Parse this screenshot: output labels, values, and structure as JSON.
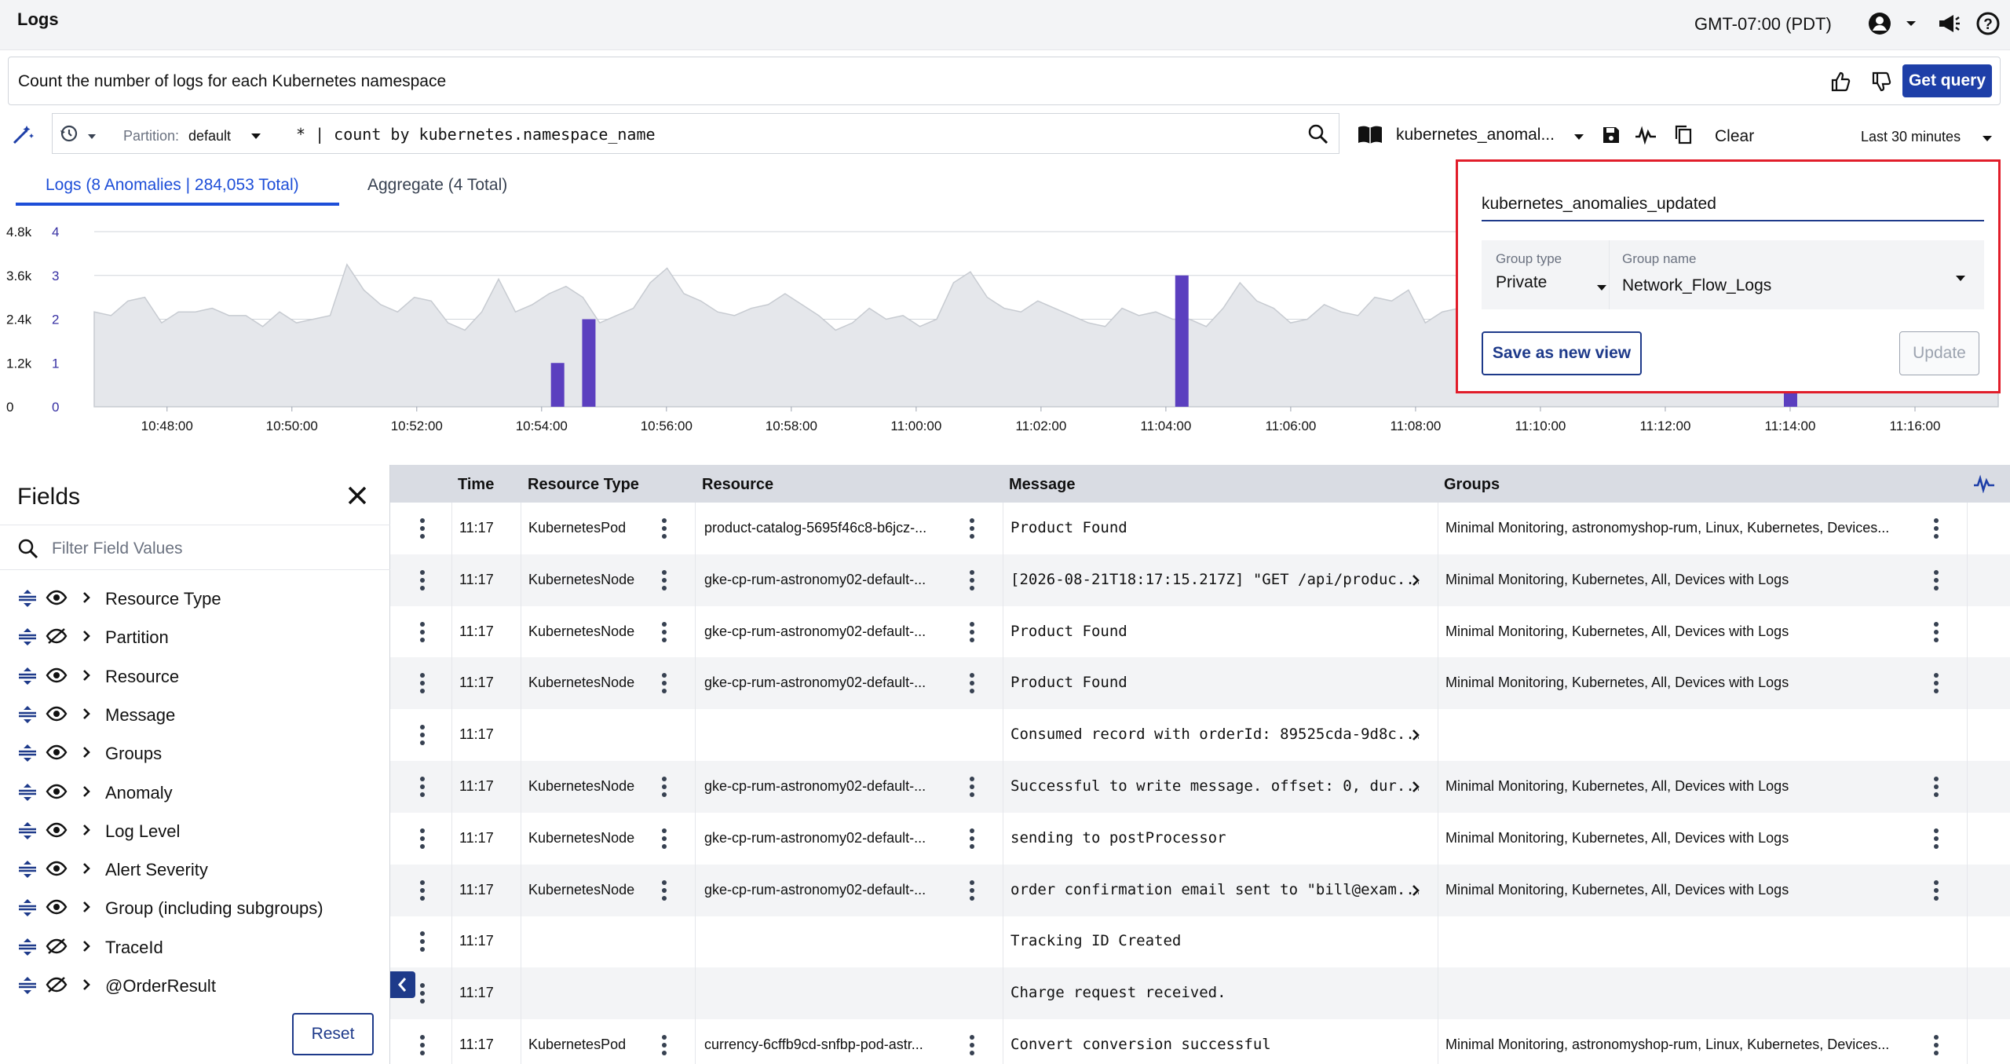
{
  "app": {
    "title": "Logs",
    "timezone": "GMT-07:00 (PDT)"
  },
  "nl_query": {
    "text": "Count the number of logs for each Kubernetes namespace",
    "get_query_label": "Get query"
  },
  "query": {
    "partition_label": "Partition:",
    "partition_value": "default",
    "text": "* | count by kubernetes.namespace_name",
    "view_name": "kubernetes_anomal...",
    "clear_label": "Clear",
    "time_range": "Last 30 minutes"
  },
  "tabs": [
    {
      "label": "Logs (8 Anomalies | 284,053 Total)",
      "active": true
    },
    {
      "label": "Aggregate (4 Total)",
      "active": false
    }
  ],
  "chart_data": {
    "type": "area",
    "y_left_ticks": [
      "4.8k",
      "3.6k",
      "2.4k",
      "1.2k",
      "0"
    ],
    "y_right_ticks": [
      "4",
      "3",
      "2",
      "1",
      "0"
    ],
    "x_ticks": [
      "10:48:00",
      "10:50:00",
      "10:52:00",
      "10:54:00",
      "10:56:00",
      "10:58:00",
      "11:00:00",
      "11:02:00",
      "11:04:00",
      "11:06:00",
      "11:08:00",
      "11:10:00",
      "11:12:00",
      "11:14:00",
      "11:16:00"
    ],
    "ylim_left": [
      0,
      4800
    ],
    "ylim_right": [
      0,
      4
    ],
    "series": [
      {
        "name": "logs",
        "color": "#e5e7eb",
        "values": [
          2600,
          2500,
          2900,
          3000,
          2300,
          2600,
          2600,
          2700,
          2500,
          2500,
          2200,
          2600,
          2300,
          2400,
          2500,
          3900,
          3200,
          2800,
          2600,
          3000,
          2900,
          2300,
          2100,
          2600,
          3500,
          2600,
          2800,
          3100,
          3300,
          3000,
          2300,
          2500,
          2700,
          3400,
          3800,
          3100,
          2900,
          2600,
          2500,
          2700,
          2800,
          3100,
          2800,
          2500,
          2100,
          2300,
          2700,
          2400,
          2500,
          2200,
          2400,
          3400,
          3700,
          3000,
          2700,
          2600,
          2900,
          2700,
          2500,
          2300,
          2200,
          2700,
          2500,
          2600,
          2400,
          2400,
          2200,
          2700,
          3400,
          2900,
          2700,
          2300,
          2400,
          2800,
          2600,
          2500,
          3000,
          2900,
          3200,
          2300,
          2600,
          2700,
          2900,
          3200,
          2600,
          2500,
          2600,
          3000,
          2400,
          3100,
          3800,
          3400,
          2800,
          2400,
          3200,
          2700,
          2500,
          3000,
          2600,
          2400,
          2300,
          2600,
          3300,
          2400,
          2600,
          3300,
          2700,
          2500,
          2400,
          3100,
          2900,
          2400,
          2800,
          3300
        ]
      },
      {
        "name": "anomalies",
        "color": "#5b3fbf",
        "points": [
          {
            "x": "10:54:15",
            "y": 1
          },
          {
            "x": "10:54:45",
            "y": 2
          },
          {
            "x": "11:04:15",
            "y": 3
          },
          {
            "x": "11:14:00",
            "y": 1
          }
        ]
      }
    ],
    "grid": true
  },
  "save_popup": {
    "view_name": "kubernetes_anomalies_updated",
    "group_type_label": "Group type",
    "group_type_value": "Private",
    "group_name_label": "Group name",
    "group_name_value": "Network_Flow_Logs",
    "save_new_label": "Save as new view",
    "update_label": "Update"
  },
  "fields_panel": {
    "title": "Fields",
    "filter_placeholder": "Filter Field Values",
    "reset_label": "Reset",
    "items": [
      {
        "label": "Resource Type",
        "visible": true
      },
      {
        "label": "Partition",
        "visible": false
      },
      {
        "label": "Resource",
        "visible": true
      },
      {
        "label": "Message",
        "visible": true
      },
      {
        "label": "Groups",
        "visible": true
      },
      {
        "label": "Anomaly",
        "visible": true
      },
      {
        "label": "Log Level",
        "visible": true
      },
      {
        "label": "Alert Severity",
        "visible": true
      },
      {
        "label": "Group (including subgroups)",
        "visible": true
      },
      {
        "label": "TraceId",
        "visible": false
      },
      {
        "label": "@OrderResult",
        "visible": false
      }
    ]
  },
  "table": {
    "columns": [
      "Time",
      "Resource Type",
      "Resource",
      "Message",
      "Groups"
    ],
    "rows": [
      {
        "time": "11:17",
        "rtype": "KubernetesPod",
        "resource": "product-catalog-5695f46c8-b6jcz-...",
        "message": "Product Found",
        "groups": "Minimal Monitoring, astronomyshop-rum, Linux, Kubernetes, Devices...",
        "more": false
      },
      {
        "time": "11:17",
        "rtype": "KubernetesNode",
        "resource": "gke-cp-rum-astronomy02-default-...",
        "message": "[2026-08-21T18:17:15.217Z] \"GET /api/produc...",
        "groups": "Minimal Monitoring, Kubernetes, All, Devices with Logs",
        "more": true
      },
      {
        "time": "11:17",
        "rtype": "KubernetesNode",
        "resource": "gke-cp-rum-astronomy02-default-...",
        "message": "Product Found",
        "groups": "Minimal Monitoring, Kubernetes, All, Devices with Logs",
        "more": false
      },
      {
        "time": "11:17",
        "rtype": "KubernetesNode",
        "resource": "gke-cp-rum-astronomy02-default-...",
        "message": "Product Found",
        "groups": "Minimal Monitoring, Kubernetes, All, Devices with Logs",
        "more": false
      },
      {
        "time": "11:17",
        "rtype": "",
        "resource": "",
        "message": "Consumed record with orderId: 89525cda-9d8c...",
        "groups": "",
        "more": true
      },
      {
        "time": "11:17",
        "rtype": "KubernetesNode",
        "resource": "gke-cp-rum-astronomy02-default-...",
        "message": "Successful to write message. offset: 0, dur...",
        "groups": "Minimal Monitoring, Kubernetes, All, Devices with Logs",
        "more": true
      },
      {
        "time": "11:17",
        "rtype": "KubernetesNode",
        "resource": "gke-cp-rum-astronomy02-default-...",
        "message": "sending to postProcessor",
        "groups": "Minimal Monitoring, Kubernetes, All, Devices with Logs",
        "more": false
      },
      {
        "time": "11:17",
        "rtype": "KubernetesNode",
        "resource": "gke-cp-rum-astronomy02-default-...",
        "message": "order confirmation email sent to \"bill@exam...",
        "groups": "Minimal Monitoring, Kubernetes, All, Devices with Logs",
        "more": true
      },
      {
        "time": "11:17",
        "rtype": "",
        "resource": "",
        "message": "Tracking ID Created",
        "groups": "",
        "more": false
      },
      {
        "time": "11:17",
        "rtype": "",
        "resource": "",
        "message": "Charge request received.",
        "groups": "",
        "more": false
      },
      {
        "time": "11:17",
        "rtype": "KubernetesPod",
        "resource": "currency-6cffb9cd-snfbp-pod-astr...",
        "message": "Convert conversion successful",
        "groups": "Minimal Monitoring, astronomyshop-rum, Linux, Kubernetes, Devices...",
        "more": false
      }
    ]
  },
  "colors": {
    "accent": "#1e3fa8",
    "anomaly": "#5b3fbf",
    "highlight_border": "#e11d2a"
  }
}
